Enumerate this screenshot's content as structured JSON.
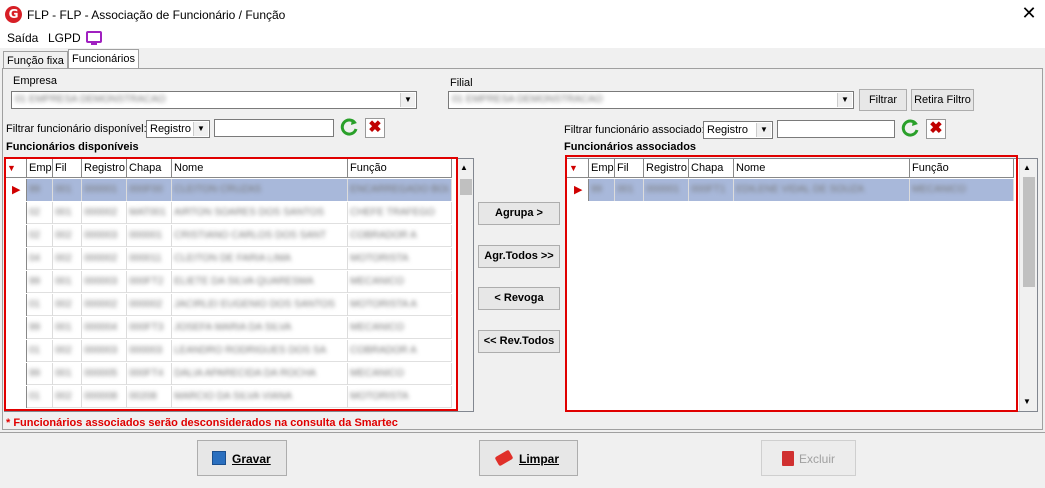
{
  "window": {
    "title": "FLP - FLP - Associação de Funcionário / Função",
    "logo": "G",
    "close": "✕"
  },
  "menu": [
    {
      "label": "Saída"
    },
    {
      "label": "LGPD"
    }
  ],
  "tabs": [
    {
      "label": "Função fixa"
    },
    {
      "label": "Funcionários"
    }
  ],
  "empresa": {
    "label": "Empresa",
    "value": "01 EMPRESA DEMONSTRACAO"
  },
  "filial": {
    "label": "Filial",
    "value": "01 EMPRESA DEMONSTRACAO",
    "filtrar": "Filtrar",
    "retira": "Retira Filtro"
  },
  "filtro_disp": {
    "label": "Filtrar funcionário disponível:",
    "select": "Registro",
    "value": ""
  },
  "filtro_assoc": {
    "label": "Filtrar funcionário associado:",
    "select": "Registro",
    "value": ""
  },
  "disponiveis": {
    "title": "Funcionários disponíveis",
    "columns": [
      "Emp",
      "Fil",
      "Registro",
      "Chapa",
      "Nome",
      "Função"
    ],
    "rows": [
      [
        "99",
        "001",
        "000001",
        "000F00",
        "CLEITON CRUZAS",
        "ENCARREGADO BOL"
      ],
      [
        "02",
        "001",
        "000002",
        "MAT001",
        "AIRTON SOARES DOS SANTOS",
        "CHEFE TRAFEGO"
      ],
      [
        "02",
        "002",
        "000003",
        "000001",
        "CRISTIANO CARLOS DOS SANT",
        "COBRADOR A"
      ],
      [
        "04",
        "002",
        "000002",
        "000011",
        "CLEITON DE FARIA LIMA",
        "MOTORISTA"
      ],
      [
        "99",
        "001",
        "000003",
        "000FT2",
        "ELIETE DA SILVA QUARESMA",
        "MECANICO"
      ],
      [
        "01",
        "002",
        "000002",
        "000002",
        "JACIRLEI EUGENIO DOS SANTOS",
        "MOTORISTA A"
      ],
      [
        "99",
        "001",
        "000004",
        "000FT3",
        "JOSEFA MARIA DA SILVA",
        "MECANICO"
      ],
      [
        "01",
        "002",
        "000003",
        "000003",
        "LEANDRO RODRIGUES DOS SA",
        "COBRADOR A"
      ],
      [
        "99",
        "001",
        "000005",
        "000FT4",
        "DALIA APARECIDA DA ROCHA",
        "MECANICO"
      ],
      [
        "01",
        "002",
        "000008",
        "00208",
        "MARCIO DA SILVA VIANA",
        "MOTORISTA"
      ],
      [
        "01",
        "001",
        "000004",
        "001004",
        "ANDERSON DOS SANTOS",
        "COBRADOR"
      ],
      [
        "99",
        "001",
        "000006",
        "000FT5",
        "RIGONETE DIAS DA SILVA",
        "MECANICO"
      ]
    ]
  },
  "associados": {
    "title": "Funcionários associados",
    "columns": [
      "Emp",
      "Fil",
      "Registro",
      "Chapa",
      "Nome",
      "Função"
    ],
    "rows": [
      [
        "99",
        "001",
        "000001",
        "000FT1",
        "EDILENE VIDAL DE SOUZA",
        "MECANICO"
      ]
    ]
  },
  "actions": {
    "agrupa": "Agrupa >",
    "agr_todos": "Agr.Todos >>",
    "revoga": "< Revoga",
    "rev_todos": "<< Rev.Todos"
  },
  "warning": "* Funcionários associados serão desconsiderados na consulta da Smartec",
  "buttons": {
    "gravar": "Gravar",
    "limpar": "Limpar",
    "excluir": "Excluir"
  },
  "colors": {
    "accent_red": "#e00000",
    "selected_row": "#a8b8da",
    "logo": "#d71f26"
  }
}
